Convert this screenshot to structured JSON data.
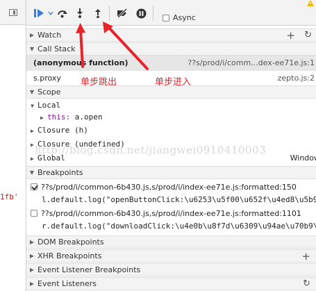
{
  "editor": {
    "code_fragment": "1fb'"
  },
  "toolbar": {
    "async_label": "Async",
    "icons": [
      "pause-resume-icon",
      "step-over-icon",
      "step-into-icon",
      "step-out-icon",
      "deactivate-breakpoints-icon",
      "pause-on-exceptions-icon",
      "warning-icon"
    ]
  },
  "watch": {
    "title": "Watch"
  },
  "call_stack": {
    "title": "Call Stack",
    "frames": [
      {
        "name": "(anonymous function)",
        "location": "??s/prod/i/comm...dex-ee71e.js:1"
      },
      {
        "name": "s.proxy",
        "location": "zepto.js:2"
      }
    ]
  },
  "scope": {
    "title": "Scope",
    "local_label": "Local",
    "this_key": "this:",
    "this_value": "a.open",
    "closure_1": "Closure (h)",
    "closure_2": "Closure (undefined)",
    "global_label": "Global",
    "global_value": "Window"
  },
  "breakpoints": {
    "title": "Breakpoints",
    "items": [
      {
        "checked": true,
        "location": "??s/prod/i/common-6b430.js,s/prod/i/index-ee71e.js:formatted:150",
        "code": "l.default.log(\"openButtonClick:\\u6253\\u5f00\\u652f\\u4ed8\\u5b9"
      },
      {
        "checked": false,
        "location": "??s/prod/i/common-6b430.js,s/prod/i/index-ee71e.js:formatted:1101",
        "code": "r.default.log(\"downloadClick:\\u4e0b\\u8f7d\\u6309\\u94ae\\u70b9\\"
      }
    ]
  },
  "dom_breakpoints": {
    "title": "DOM Breakpoints"
  },
  "xhr_breakpoints": {
    "title": "XHR Breakpoints"
  },
  "event_listener_breakpoints": {
    "title": "Event Listener Breakpoints"
  },
  "event_listeners": {
    "title": "Event Listeners"
  },
  "watermark": "http://blog.csdn.net/jiangwei0910410003",
  "annotations": {
    "step_out": "单步跳出",
    "step_into": "单步进入"
  },
  "colors": {
    "accent_blue": "#3a7bd5",
    "annotation_red": "#e8232a",
    "keyword_purple": "#881391",
    "string_red": "#c41a16"
  }
}
